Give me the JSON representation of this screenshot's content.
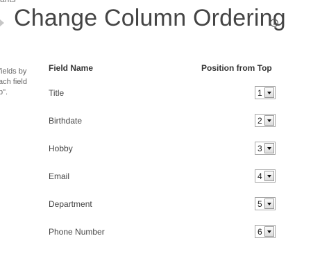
{
  "breadcrumb": {
    "fragment": "ants"
  },
  "header": {
    "title": "Change Column Ordering",
    "info_icon": "info-circle-icon"
  },
  "description": {
    "lines": [
      "fields by",
      "ach field",
      "p\"."
    ]
  },
  "table": {
    "headers": {
      "field_name": "Field Name",
      "position": "Position from Top"
    },
    "rows": [
      {
        "field": "Title",
        "position": "1"
      },
      {
        "field": "Birthdate",
        "position": "2"
      },
      {
        "field": "Hobby",
        "position": "3"
      },
      {
        "field": "Email",
        "position": "4"
      },
      {
        "field": "Department",
        "position": "5"
      },
      {
        "field": "Phone Number",
        "position": "6"
      }
    ]
  },
  "icons": {
    "breadcrumb_arrow": "chevron-right-icon",
    "select_arrow": "chevron-down-icon"
  }
}
